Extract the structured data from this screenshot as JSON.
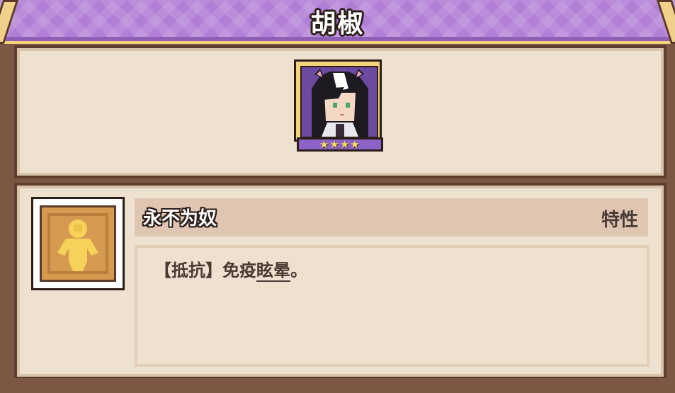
{
  "character": {
    "name": "胡椒",
    "stars": "★★★★",
    "star_count": 4
  },
  "skill": {
    "name": "永不为奴",
    "type": "特性",
    "description_prefix": "【抵抗】免疫",
    "description_link": "眩晕",
    "description_suffix": "。"
  },
  "colors": {
    "banner_purple": "#b27fd6",
    "panel_bg": "#efe1cf",
    "frame_brown": "#7c5744",
    "accent_gold": "#f3d27a"
  },
  "icons": {
    "portrait": "character-portrait",
    "skill": "figure-silhouette-icon"
  }
}
